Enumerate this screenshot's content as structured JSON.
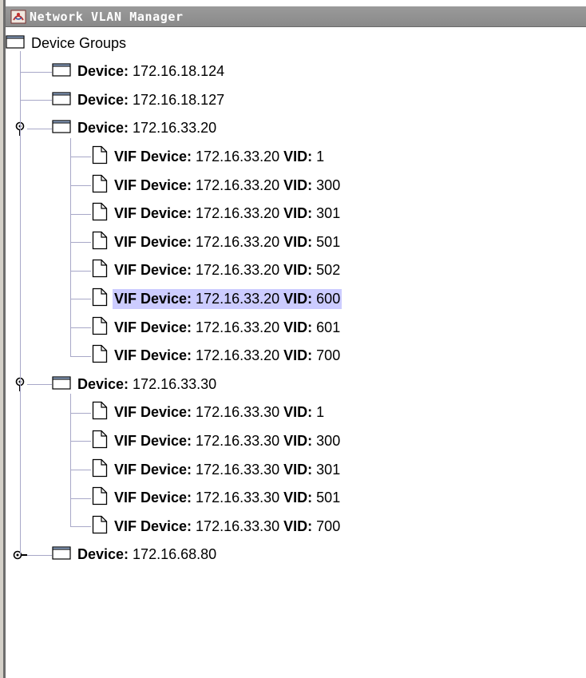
{
  "window": {
    "title": "Network VLAN Manager",
    "icon": "java-app-icon"
  },
  "colors": {
    "titlebar": "#8e8e8e",
    "selection": "#ccccff",
    "tree_lines": "#a8a8c8",
    "frame": "#6d6d6d"
  },
  "tree": {
    "root": {
      "label": "Device Groups",
      "icon": "folder-icon"
    },
    "device_prefix": "Device:",
    "vif_prefix": "VIF Device:",
    "vid_prefix": "VID:",
    "devices": [
      {
        "ip": "172.16.18.124",
        "state": "leaf",
        "vifs": []
      },
      {
        "ip": "172.16.18.127",
        "state": "leaf",
        "vifs": []
      },
      {
        "ip": "172.16.33.20",
        "state": "expanded",
        "vifs": [
          {
            "ip": "172.16.33.20",
            "vid": "1"
          },
          {
            "ip": "172.16.33.20",
            "vid": "300"
          },
          {
            "ip": "172.16.33.20",
            "vid": "301"
          },
          {
            "ip": "172.16.33.20",
            "vid": "501"
          },
          {
            "ip": "172.16.33.20",
            "vid": "502"
          },
          {
            "ip": "172.16.33.20",
            "vid": "600",
            "selected": true
          },
          {
            "ip": "172.16.33.20",
            "vid": "601"
          },
          {
            "ip": "172.16.33.20",
            "vid": "700"
          }
        ]
      },
      {
        "ip": "172.16.33.30",
        "state": "expanded",
        "vifs": [
          {
            "ip": "172.16.33.30",
            "vid": "1"
          },
          {
            "ip": "172.16.33.30",
            "vid": "300"
          },
          {
            "ip": "172.16.33.30",
            "vid": "301"
          },
          {
            "ip": "172.16.33.30",
            "vid": "501"
          },
          {
            "ip": "172.16.33.30",
            "vid": "700"
          }
        ]
      },
      {
        "ip": "172.16.68.80",
        "state": "collapsed",
        "vifs": []
      }
    ]
  }
}
